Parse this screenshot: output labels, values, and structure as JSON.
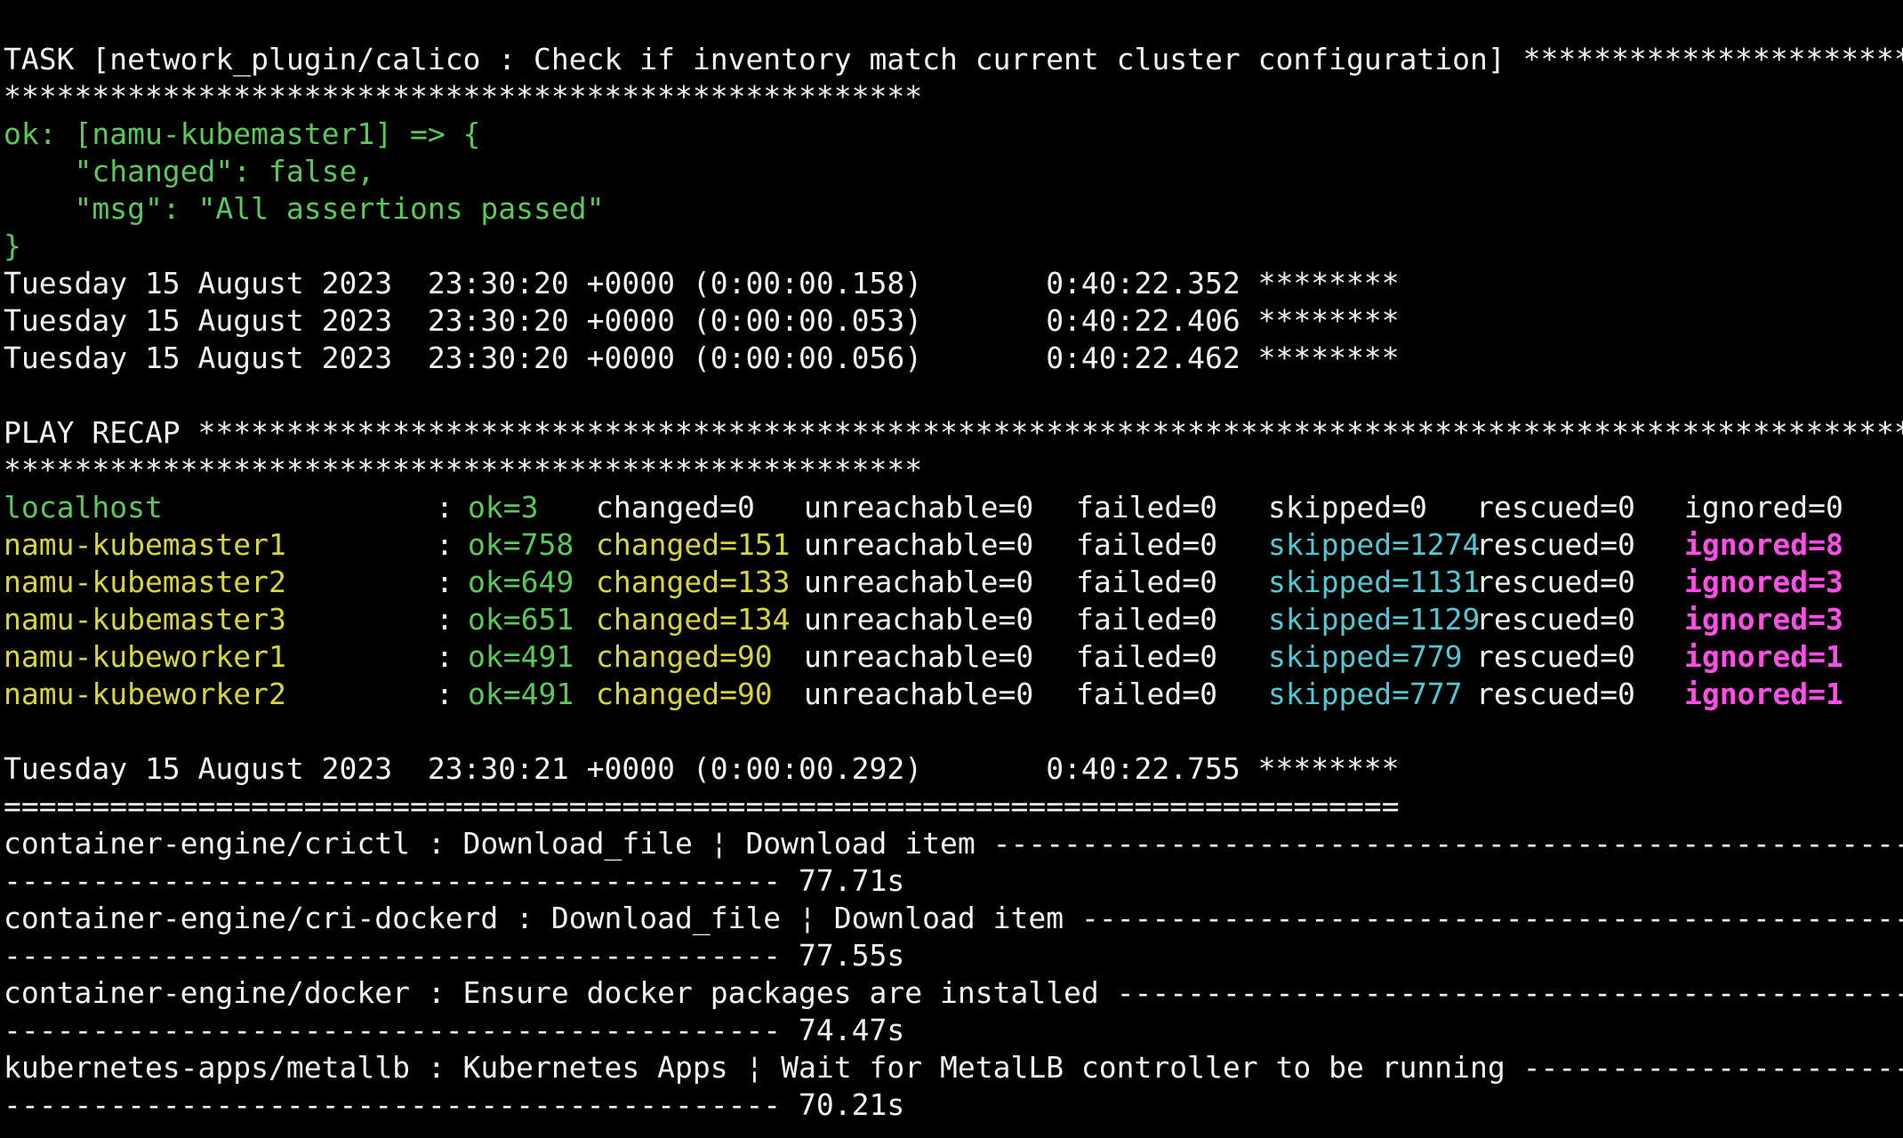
{
  "terminal": {
    "colors": {
      "background": "#000000",
      "text": "#f2f2f2",
      "ok_green": "#5ac85a",
      "changed_yellow": "#d6d63c",
      "skipped_cyan": "#56c6d0",
      "ignored_magenta": "#ff4fe6"
    },
    "task": {
      "header": "TASK [network_plugin/calico : Check if inventory match current cluster configuration] ******************************************",
      "stars": "****************************************************",
      "ok_line": "ok: [namu-kubemaster1] => {",
      "changed": "    \"changed\": false,",
      "msg": "    \"msg\": \"All assertions passed\"",
      "close": "}"
    },
    "timestamps": [
      "Tuesday 15 August 2023  23:30:20 +0000 (0:00:00.158)       0:40:22.352 ********",
      "Tuesday 15 August 2023  23:30:20 +0000 (0:00:00.053)       0:40:22.406 ********",
      "Tuesday 15 August 2023  23:30:20 +0000 (0:00:00.056)       0:40:22.462 ********"
    ],
    "recap": {
      "header": "PLAY RECAP ***********************************************************************************************************************",
      "stars": "****************************************************",
      "hosts": [
        {
          "name": "localhost",
          "sep": ": ",
          "ok": "ok=3",
          "changed": "changed=0",
          "unreachable": "unreachable=0",
          "failed": "failed=0",
          "skipped": "skipped=0",
          "rescued": "rescued=0",
          "ignored": "ignored=0"
        },
        {
          "name": "namu-kubemaster1",
          "sep": ": ",
          "ok": "ok=758",
          "changed": "changed=151",
          "unreachable": "unreachable=0",
          "failed": "failed=0",
          "skipped": "skipped=1274",
          "rescued": "rescued=0",
          "ignored": "ignored=8"
        },
        {
          "name": "namu-kubemaster2",
          "sep": ": ",
          "ok": "ok=649",
          "changed": "changed=133",
          "unreachable": "unreachable=0",
          "failed": "failed=0",
          "skipped": "skipped=1131",
          "rescued": "rescued=0",
          "ignored": "ignored=3"
        },
        {
          "name": "namu-kubemaster3",
          "sep": ": ",
          "ok": "ok=651",
          "changed": "changed=134",
          "unreachable": "unreachable=0",
          "failed": "failed=0",
          "skipped": "skipped=1129",
          "rescued": "rescued=0",
          "ignored": "ignored=3"
        },
        {
          "name": "namu-kubeworker1",
          "sep": ": ",
          "ok": "ok=491",
          "changed": "changed=90",
          "unreachable": "unreachable=0",
          "failed": "failed=0",
          "skipped": "skipped=779",
          "rescued": "rescued=0",
          "ignored": "ignored=1"
        },
        {
          "name": "namu-kubeworker2",
          "sep": ": ",
          "ok": "ok=491",
          "changed": "changed=90",
          "unreachable": "unreachable=0",
          "failed": "failed=0",
          "skipped": "skipped=777",
          "rescued": "rescued=0",
          "ignored": "ignored=1"
        }
      ]
    },
    "final_timestamp": "Tuesday 15 August 2023  23:30:21 +0000 (0:00:00.292)       0:40:22.755 ********",
    "separator": "===============================================================================",
    "profile": [
      {
        "task": "container-engine/crictl : Download_file ¦ Download item ---------------------------------------------------------------",
        "dashes": "--------------------------------------------",
        "time": " 77.71s"
      },
      {
        "task": "container-engine/cri-dockerd : Download_file ¦ Download item ----------------------------------------------------------",
        "dashes": "--------------------------------------------",
        "time": " 77.55s"
      },
      {
        "task": "container-engine/docker : Ensure docker packages are installed ------------------------------------------------------------",
        "dashes": "--------------------------------------------",
        "time": " 74.47s"
      },
      {
        "task": "kubernetes-apps/metallb : Kubernetes Apps ¦ Wait for MetalLB controller to be running ---------------------------------",
        "dashes": "--------------------------------------------",
        "time": " 70.21s"
      }
    ]
  }
}
